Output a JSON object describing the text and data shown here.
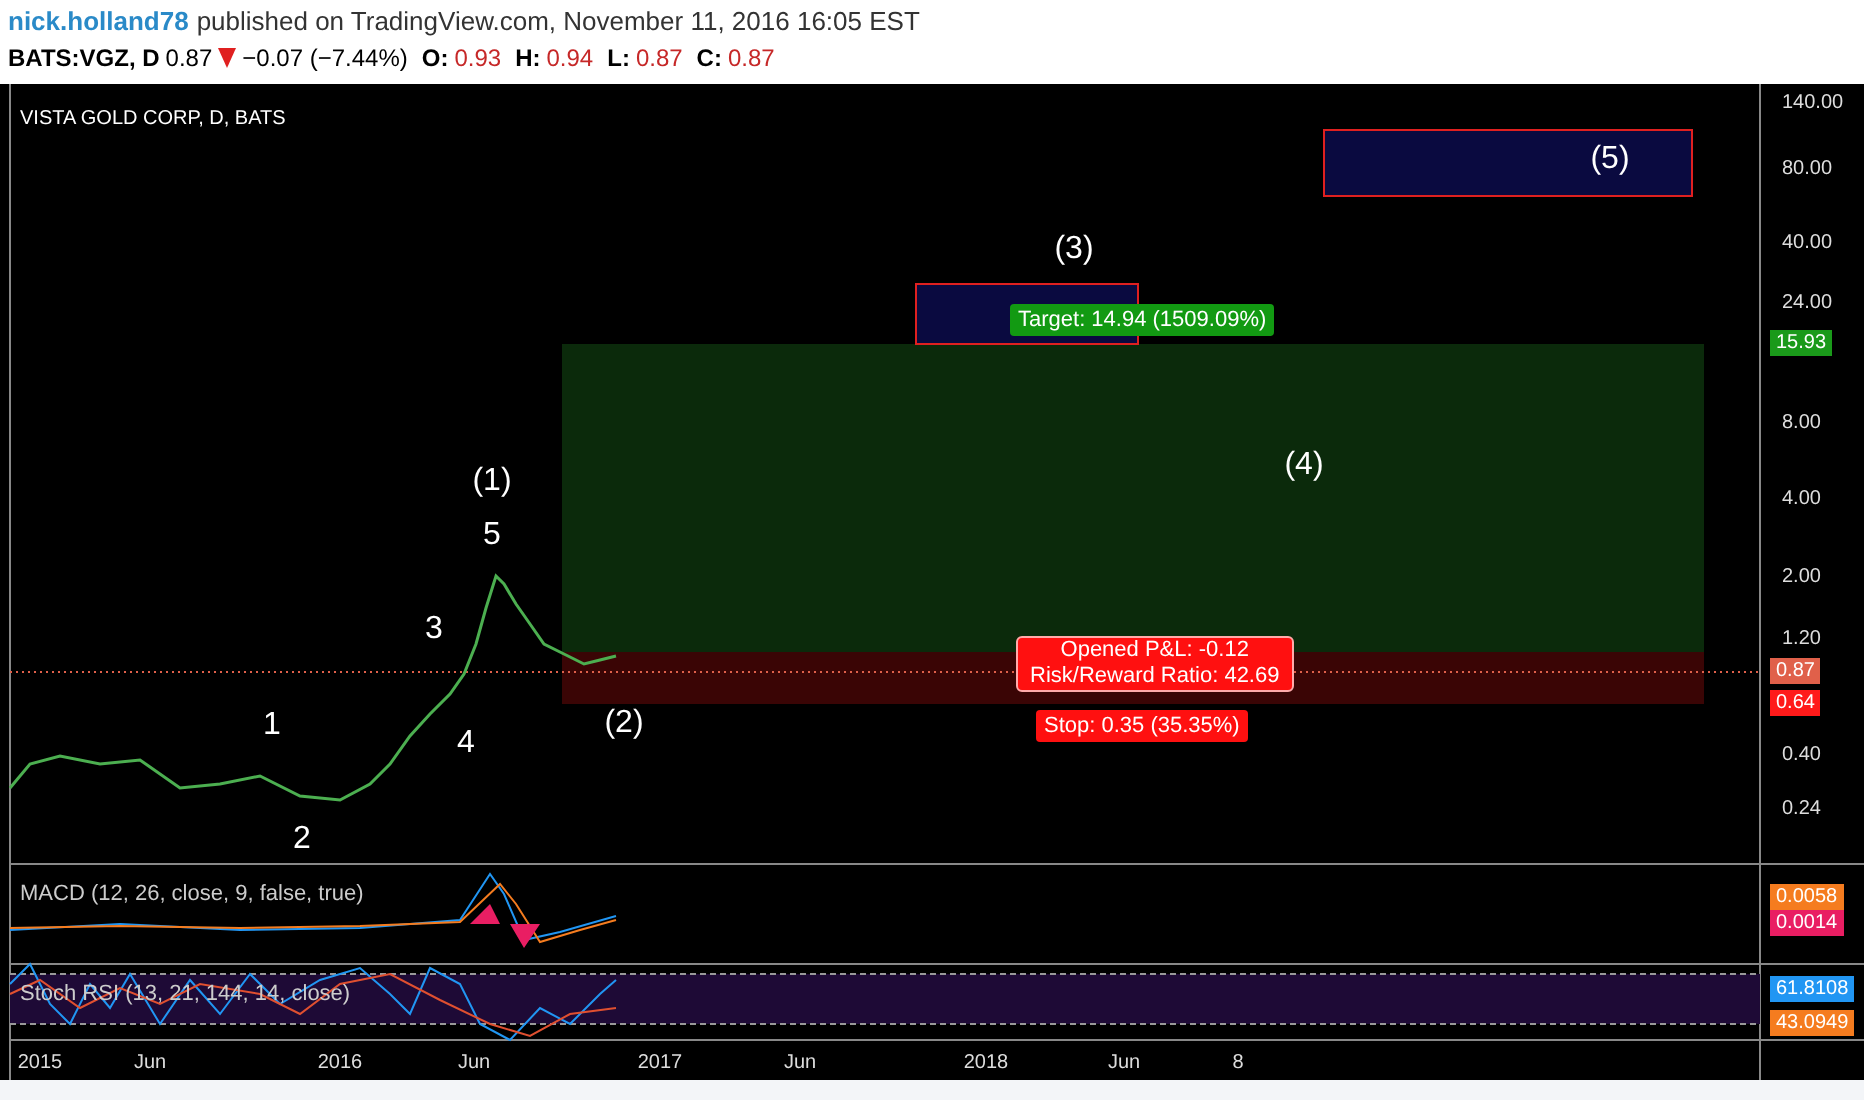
{
  "header": {
    "author": "nick.holland78",
    "published": "published on TradingView.com, November 11, 2016 16:05 EST"
  },
  "symbol_line": {
    "symbol": "BATS:VGZ, D",
    "price": "0.87",
    "falling": true,
    "change": "−0.07 (−7.44%)",
    "ohlc": [
      {
        "label": "O:",
        "value": "0.93"
      },
      {
        "label": "H:",
        "value": "0.94"
      },
      {
        "label": "L:",
        "value": "0.87"
      },
      {
        "label": "C:",
        "value": "0.87"
      }
    ]
  },
  "chart": {
    "title": "VISTA GOLD CORP, D, BATS",
    "price_axis": [
      "140.00",
      "80.00",
      "40.00",
      "24.00",
      "8.00",
      "4.00",
      "2.00",
      "1.20",
      "0.40",
      "0.24"
    ],
    "price_badges": [
      {
        "text": "15.93",
        "color": "#1a9a1a"
      },
      {
        "text": "0.87",
        "color": "#e0604a"
      },
      {
        "text": "0.64",
        "color": "#ff1a1a"
      }
    ],
    "wave_labels": [
      "(1)",
      "5",
      "3",
      "4",
      "1",
      "2",
      "(2)",
      "(3)",
      "(4)",
      "(5)"
    ],
    "position": {
      "target": "Target: 14.94 (1509.09%)",
      "pnl": "Opened P&L: -0.12",
      "risk_reward": "Risk/Reward Ratio: 42.69",
      "stop": "Stop: 0.35 (35.35%)"
    }
  },
  "macd": {
    "label": "MACD (12, 26, close, 9, false, true)",
    "badges": [
      {
        "text": "0.0058",
        "color": "#f57c1f"
      },
      {
        "text": "0.0014",
        "color": "#e91e63"
      }
    ]
  },
  "stoch_rsi": {
    "label": "Stoch RSI (13, 21, 144, 14, close)",
    "badges": [
      {
        "text": "61.8108",
        "color": "#2196f3"
      },
      {
        "text": "43.0949",
        "color": "#f57c1f"
      }
    ]
  },
  "time_axis": [
    "2015",
    "Jun",
    "2016",
    "Jun",
    "2017",
    "Jun",
    "2018",
    "Jun",
    "8"
  ]
}
